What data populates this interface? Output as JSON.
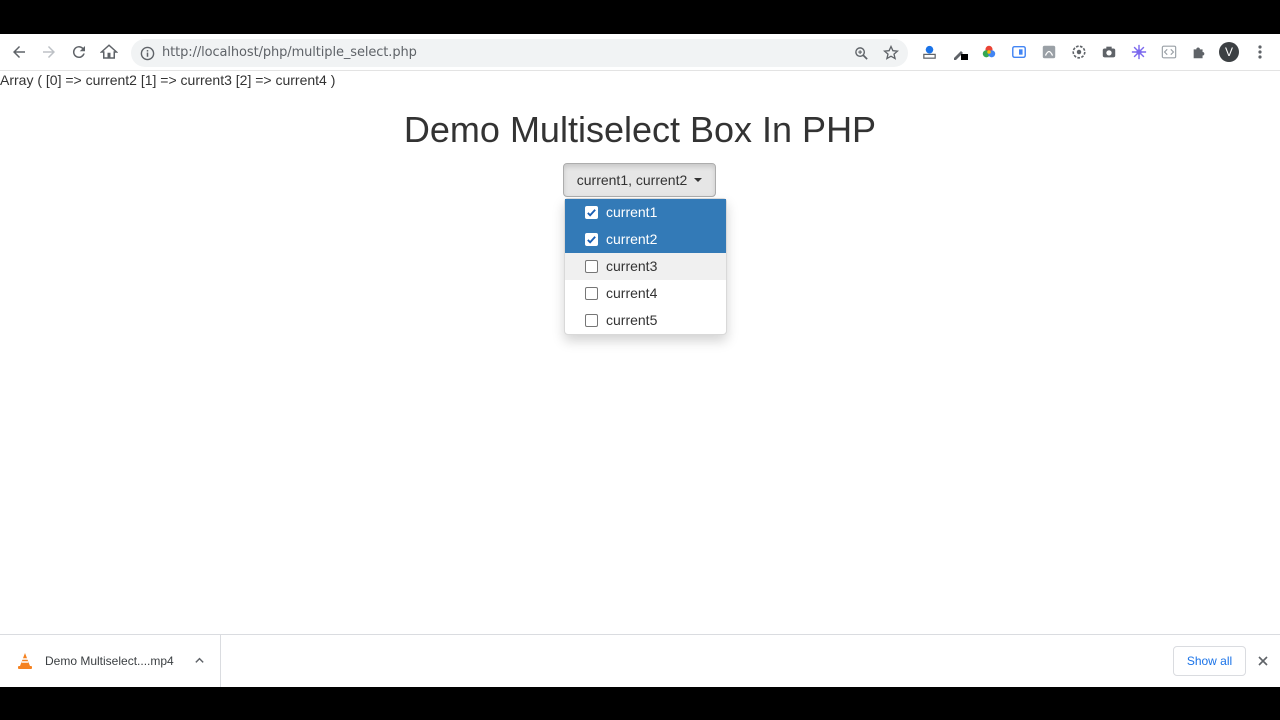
{
  "browser": {
    "url": "http://localhost/php/multiple_select.php",
    "profile_initial": "V",
    "icons": {
      "back": "back-arrow-icon",
      "forward": "forward-arrow-icon",
      "reload": "reload-icon",
      "home": "home-icon",
      "info": "info-icon",
      "zoom": "zoom-icon",
      "bookmark": "star-icon",
      "menu": "kebab-menu-icon"
    }
  },
  "page": {
    "array_output": "Array ( [0] => current2 [1] => current3 [2] => current4 )",
    "title": "Demo Multiselect Box In PHP",
    "multiselect": {
      "button_text": "current1, current2",
      "options": [
        {
          "label": "current1",
          "checked": true
        },
        {
          "label": "current2",
          "checked": true
        },
        {
          "label": "current3",
          "checked": false
        },
        {
          "label": "current4",
          "checked": false
        },
        {
          "label": "current5",
          "checked": false
        }
      ],
      "selected_color": "#337ab7"
    }
  },
  "downloads": {
    "item_name": "Demo Multiselect....mp4",
    "show_all_label": "Show all"
  }
}
